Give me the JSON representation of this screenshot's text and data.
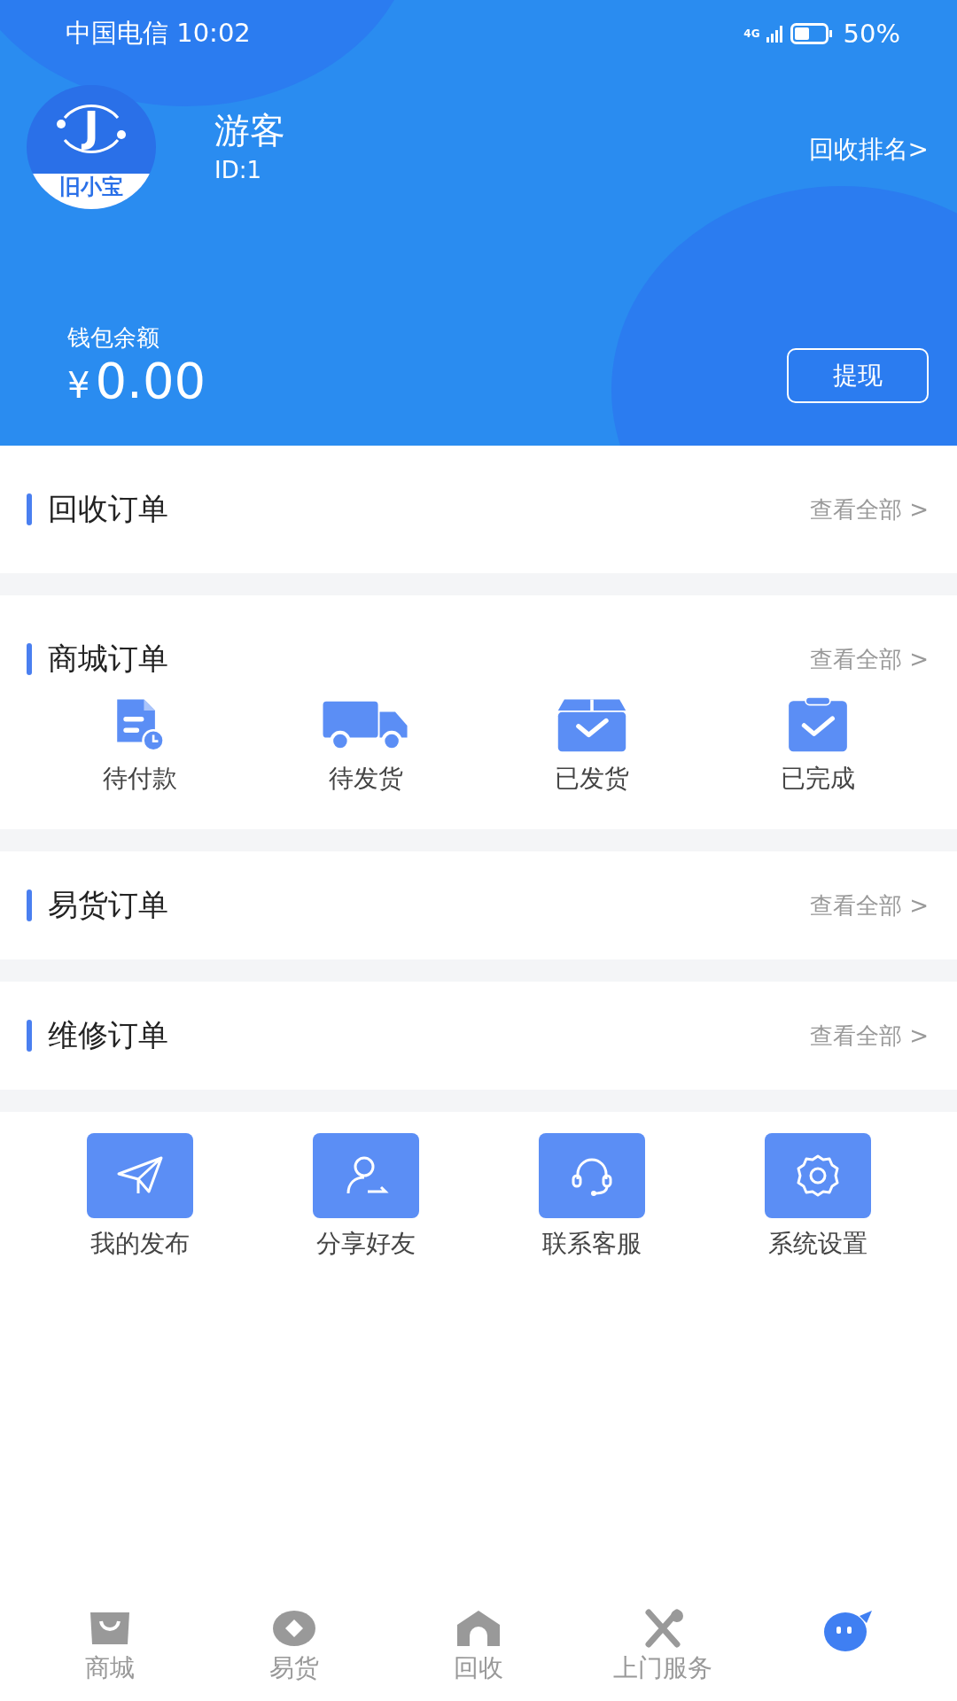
{
  "status_bar": {
    "carrier": "中国电信",
    "time": "10:02",
    "network": "4G",
    "battery": "50%"
  },
  "profile": {
    "avatar": {
      "letter": "J",
      "caption": "旧小宝"
    },
    "name": "游客",
    "id": "ID:1",
    "ranking_link": "回收排名>"
  },
  "wallet": {
    "label": "钱包余额",
    "currency": "¥",
    "amount": "0.00",
    "withdraw_button": "提现"
  },
  "order_sections": [
    {
      "title": "回收订单",
      "view_all": "查看全部 >"
    },
    {
      "title": "商城订单",
      "view_all": "查看全部 >",
      "statuses": [
        {
          "label": "待付款",
          "kind": "pending-payment"
        },
        {
          "label": "待发货",
          "kind": "truck"
        },
        {
          "label": "已发货",
          "kind": "box"
        },
        {
          "label": "已完成",
          "kind": "clipboard"
        }
      ]
    },
    {
      "title": "易货订单",
      "view_all": "查看全部 >"
    },
    {
      "title": "维修订单",
      "view_all": "查看全部 >"
    }
  ],
  "tools": [
    {
      "label": "我的发布",
      "kind": "plane"
    },
    {
      "label": "分享好友",
      "kind": "share-user"
    },
    {
      "label": "联系客服",
      "kind": "headset"
    },
    {
      "label": "系统设置",
      "kind": "gear"
    }
  ],
  "tabs": [
    {
      "label": "商城",
      "kind": "bag",
      "selected": false
    },
    {
      "label": "易货",
      "kind": "coin",
      "selected": false
    },
    {
      "label": "回收",
      "kind": "home",
      "selected": false
    },
    {
      "label": "上门服务",
      "kind": "tools",
      "selected": false
    },
    {
      "kind": "chat",
      "selected": true
    }
  ]
}
